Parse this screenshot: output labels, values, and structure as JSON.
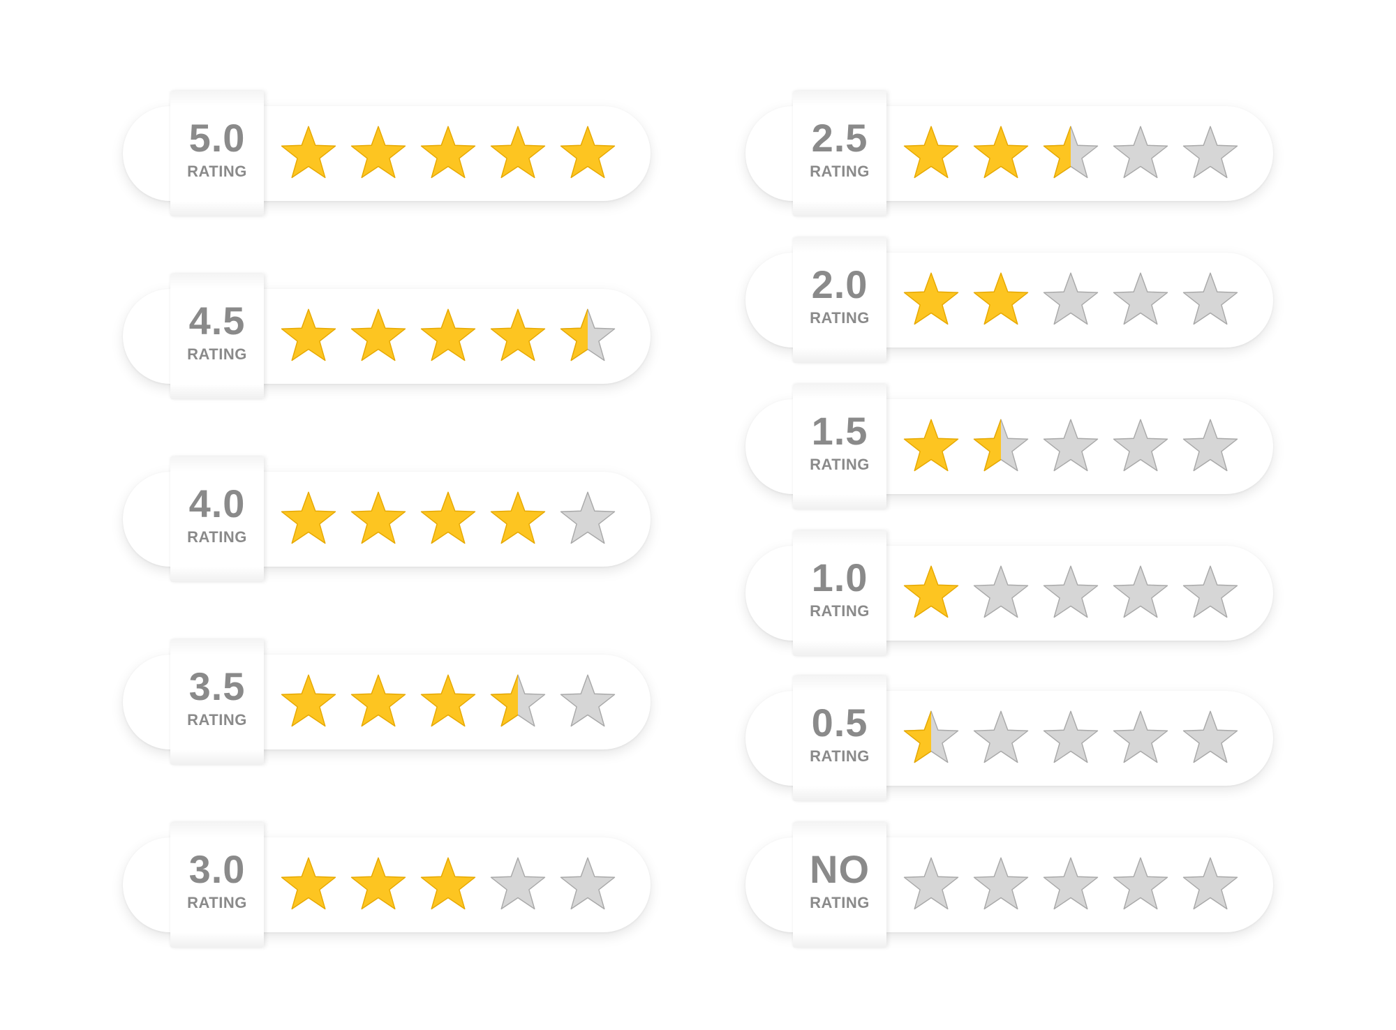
{
  "colors": {
    "filled": "#FDC521",
    "filled_stroke": "#E6A800",
    "empty": "#D6D6D6",
    "empty_stroke": "#A8A8A8",
    "label_text": "#8A8A8A"
  },
  "star_icon": "star-icon",
  "max_stars": 5,
  "ratings": [
    {
      "label": "5.0",
      "sub": "RATING",
      "value": 5.0
    },
    {
      "label": "4.5",
      "sub": "RATING",
      "value": 4.5
    },
    {
      "label": "4.0",
      "sub": "RATING",
      "value": 4.0
    },
    {
      "label": "3.5",
      "sub": "RATING",
      "value": 3.5
    },
    {
      "label": "3.0",
      "sub": "RATING",
      "value": 3.0
    },
    {
      "label": "2.5",
      "sub": "RATING",
      "value": 2.5
    },
    {
      "label": "2.0",
      "sub": "RATING",
      "value": 2.0
    },
    {
      "label": "1.5",
      "sub": "RATING",
      "value": 1.5
    },
    {
      "label": "1.0",
      "sub": "RATING",
      "value": 1.0
    },
    {
      "label": "0.5",
      "sub": "RATING",
      "value": 0.5
    },
    {
      "label": "NO",
      "sub": "RATING",
      "value": 0
    }
  ]
}
